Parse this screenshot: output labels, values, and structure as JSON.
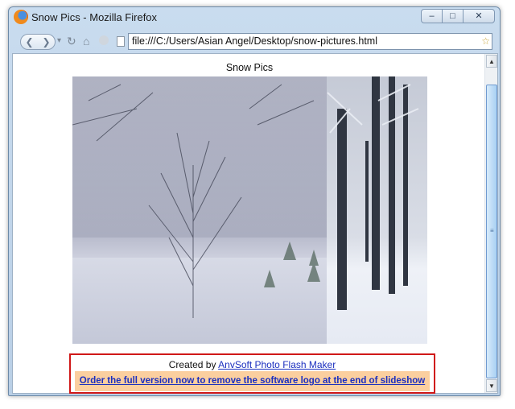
{
  "window": {
    "title": "Snow Pics - Mozilla Firefox",
    "controls": {
      "minimize": "–",
      "maximize": "□",
      "close": "✕"
    }
  },
  "navbar": {
    "back": "❮",
    "forward": "❯",
    "dropdown": "▾",
    "reload": "↻",
    "home": "⌂",
    "url": "file:///C:/Users/Asian Angel/Desktop/snow-pictures.html",
    "bookmark_star": "☆"
  },
  "page": {
    "title": "Snow Pics",
    "created_by_prefix": "Created by",
    "created_by_link": "AnvSoft Photo Flash Maker",
    "order_link": "Order the full version now to remove the software logo at the end of slideshow"
  },
  "scrollbar": {
    "up": "▲",
    "down": "▼",
    "grip": "≡"
  },
  "colors": {
    "banner_bg": "#fbcf9f",
    "highlight_border": "#d01818",
    "link": "#1b2fbf"
  }
}
